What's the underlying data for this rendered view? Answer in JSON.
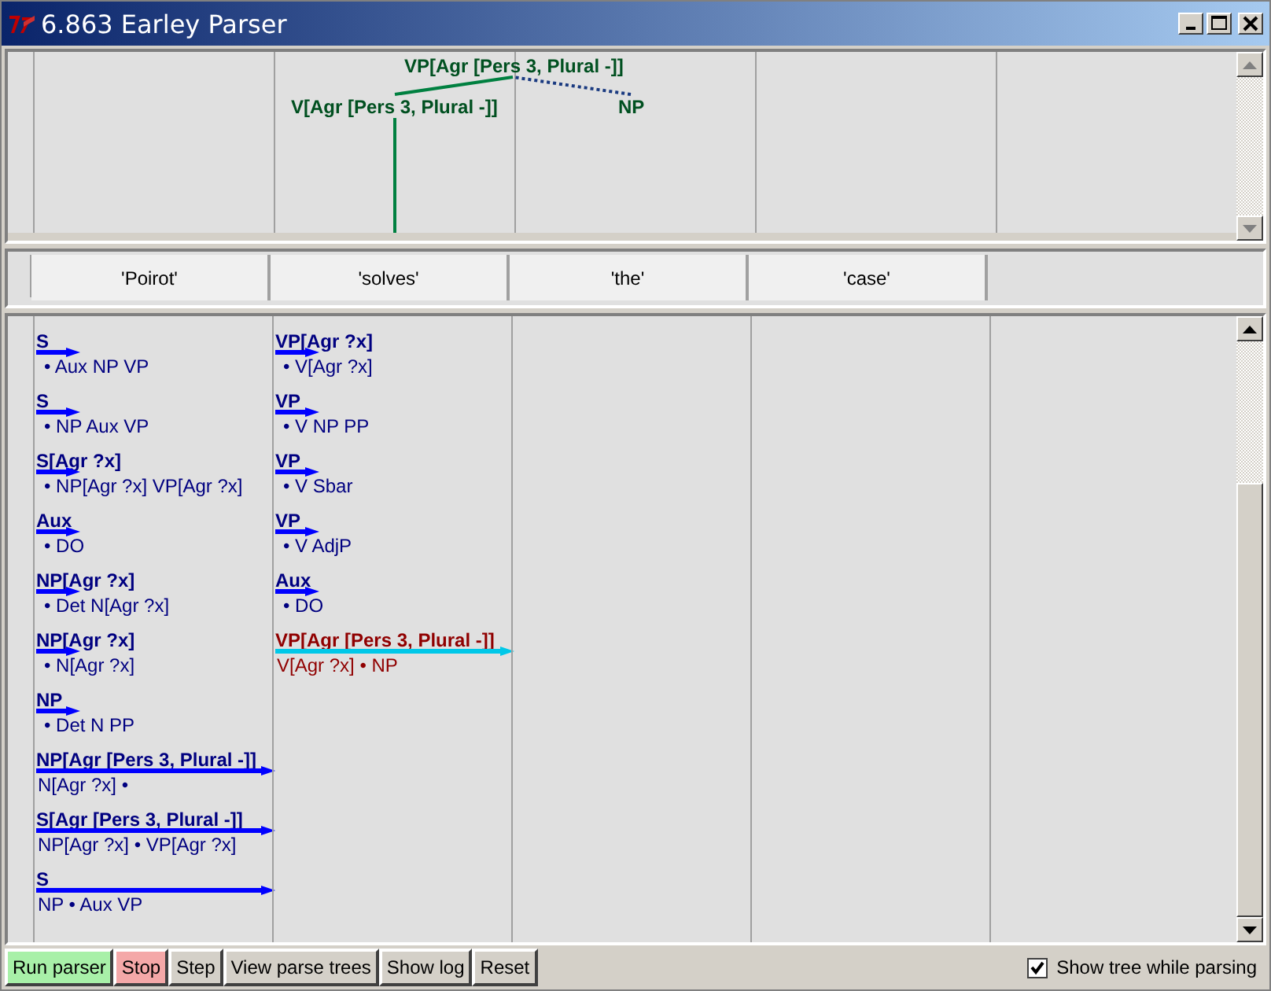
{
  "window": {
    "title": "6.863 Earley Parser"
  },
  "tree": {
    "label": "VP[Agr [Pers 3, Plural -]]",
    "children": [
      {
        "label": "V[Agr [Pers 3, Plural -]]",
        "complete": true
      },
      {
        "label": "NP",
        "complete": false
      }
    ]
  },
  "words": [
    "'Poirot'",
    "'solves'",
    "'the'",
    "'case'"
  ],
  "chart": {
    "columns": [
      {
        "edges": [
          {
            "label": "S",
            "rhs": "• Aux NP VP",
            "kind": "predicted",
            "selected": false
          },
          {
            "label": "S",
            "rhs": "• NP Aux VP",
            "kind": "predicted",
            "selected": false
          },
          {
            "label": "S[Agr ?x]",
            "rhs": "• NP[Agr ?x] VP[Agr ?x]",
            "kind": "predicted",
            "selected": false
          },
          {
            "label": "Aux",
            "rhs": "• DO",
            "kind": "predicted",
            "selected": false
          },
          {
            "label": "NP[Agr ?x]",
            "rhs": "• Det N[Agr ?x]",
            "kind": "predicted",
            "selected": false
          },
          {
            "label": "NP[Agr ?x]",
            "rhs": "• N[Agr ?x]",
            "kind": "predicted",
            "selected": false
          },
          {
            "label": "NP",
            "rhs": "• Det N PP",
            "kind": "predicted",
            "selected": false
          },
          {
            "label": "NP[Agr [Pers 3, Plural -]]",
            "rhs": "N[Agr ?x] •",
            "kind": "complete",
            "selected": false
          },
          {
            "label": "S[Agr [Pers 3, Plural -]]",
            "rhs": "NP[Agr ?x] • VP[Agr ?x]",
            "kind": "complete",
            "selected": false
          },
          {
            "label": "S",
            "rhs": "NP • Aux VP",
            "kind": "complete",
            "selected": false
          }
        ]
      },
      {
        "edges": [
          {
            "label": "VP[Agr ?x]",
            "rhs": "• V[Agr ?x]",
            "kind": "predicted",
            "selected": false
          },
          {
            "label": "VP",
            "rhs": "• V NP PP",
            "kind": "predicted",
            "selected": false
          },
          {
            "label": "VP",
            "rhs": "• V Sbar",
            "kind": "predicted",
            "selected": false
          },
          {
            "label": "VP",
            "rhs": "• V AdjP",
            "kind": "predicted",
            "selected": false
          },
          {
            "label": "Aux",
            "rhs": "• DO",
            "kind": "predicted",
            "selected": false
          },
          {
            "label": "VP[Agr [Pers 3, Plural -]]",
            "rhs": "V[Agr ?x] • NP",
            "kind": "complete",
            "selected": true
          }
        ]
      }
    ]
  },
  "buttons": [
    {
      "label": "Run parser",
      "color": "#a8f0a8"
    },
    {
      "label": "Stop",
      "color": "#f4a8a8"
    },
    {
      "label": "Step",
      "color": "#d4d0c8"
    },
    {
      "label": "View parse trees",
      "color": "#d4d0c8"
    },
    {
      "label": "Show log",
      "color": "#d4d0c8"
    },
    {
      "label": "Reset",
      "color": "#d4d0c8"
    }
  ],
  "show_tree": {
    "label": "Show tree while parsing",
    "checked": true
  }
}
